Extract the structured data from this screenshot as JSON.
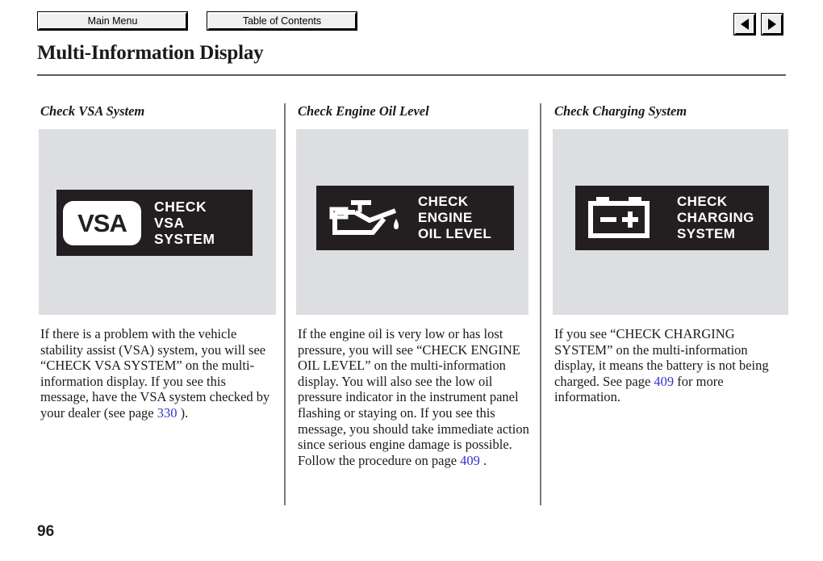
{
  "toolbar": {
    "main_menu_label": "Main Menu",
    "table_of_contents_label": "Table of Contents",
    "prev_icon": "triangle-left-icon",
    "next_icon": "triangle-right-icon"
  },
  "header": {
    "title": "Multi-Information Display"
  },
  "columns": [
    {
      "heading": "Check VSA System",
      "display": {
        "logo_text": "VSA",
        "message": "CHECK\nVSA\nSYSTEM",
        "background": "#231f20",
        "foreground": "#ffffff"
      },
      "body": {
        "before": "If there is a problem with the vehicle stability assist (VSA) system, you will see “CHECK VSA SYSTEM” on the multi-information display. If you see this message, have the VSA system checked by your dealer (see page ",
        "link": "330",
        "after": " )."
      }
    },
    {
      "heading": "Check Engine Oil Level",
      "display": {
        "icon": "oil-can-icon",
        "message": "CHECK\nENGINE\nOIL LEVEL",
        "background": "#231f20",
        "foreground": "#ffffff"
      },
      "body": {
        "before": "If the engine oil is very low or has lost pressure, you will see “CHECK ENGINE OIL LEVEL” on the multi-information display. You will also see the low oil pressure indicator in the instrument panel flashing or staying on. If you see this message, you should take immediate action since serious engine damage is possible. Follow the procedure on page ",
        "link": "409",
        "after": " ."
      }
    },
    {
      "heading": "Check Charging System",
      "display": {
        "icon": "battery-icon",
        "message": "CHECK\nCHARGING\nSYSTEM",
        "background": "#231f20",
        "foreground": "#ffffff"
      },
      "body": {
        "before": "If you see “CHECK CHARGING SYSTEM” on the multi-information display, it means the battery is not being charged. See page ",
        "link": "409",
        "after": " for more information."
      }
    }
  ],
  "footer": {
    "page_number": "96"
  },
  "colors": {
    "panel_background": "#dddee1",
    "display_background": "#231f20",
    "link": "#3333cc",
    "rule": "#5c5c5c"
  }
}
